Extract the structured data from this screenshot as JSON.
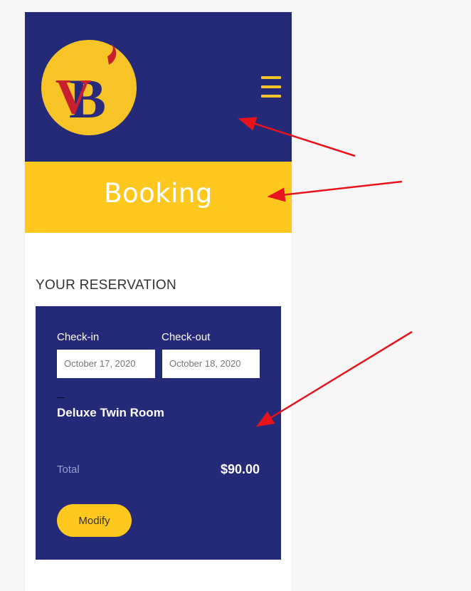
{
  "header": {
    "logo_text": "VB",
    "menu_icon": "hamburger-icon"
  },
  "banner": {
    "title": "Booking"
  },
  "reservation": {
    "section_title": "YOUR RESERVATION",
    "checkin_label": "Check-in",
    "checkout_label": "Check-out",
    "checkin_value": "October 17, 2020",
    "checkout_value": "October 18, 2020",
    "room_name": "Deluxe Twin Room",
    "total_label": "Total",
    "total_value": "$90.00",
    "modify_label": "Modify"
  },
  "colors": {
    "navy": "#242a78",
    "yellow": "#fec81e",
    "annotation_red": "#e8141c"
  }
}
